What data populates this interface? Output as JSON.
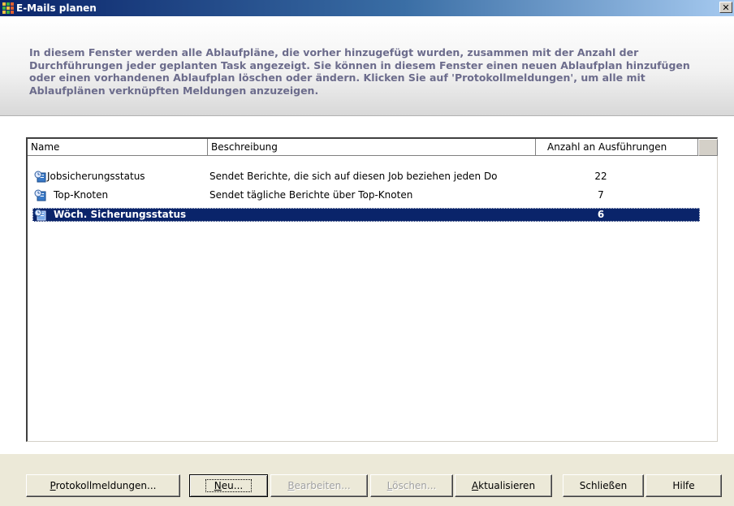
{
  "window": {
    "title": "E-Mails planen",
    "close_glyph": "✕"
  },
  "header": {
    "description": "In diesem Fenster werden alle Ablaufpläne, die vorher hinzugefügt wurden, zusammen mit der Anzahl der Durchführungen jeder geplanten Task angezeigt. Sie können in diesem Fenster einen neuen Ablaufplan hinzufügen oder einen vorhandenen Ablaufplan löschen oder ändern. Klicken Sie auf 'Protokollmeldungen', um alle mit Ablaufplänen verknüpften Meldungen anzuzeigen."
  },
  "list": {
    "columns": [
      "Name",
      "Beschreibung",
      "Anzahl an Ausführungen"
    ],
    "rows": [
      {
        "name": "Jobsicherungsstatus",
        "description": "Sendet Berichte, die sich auf diesen Job beziehen jeden Do",
        "count": "22",
        "icon": "email-schedule-icon",
        "selected": false
      },
      {
        "name": "Top-Knoten",
        "description": "Sendet tägliche Berichte über Top-Knoten",
        "count": "7",
        "icon": "email-schedule-icon",
        "selected": false
      },
      {
        "name": "Wöch. Sicherungsstatus",
        "description": "",
        "count": "6",
        "icon": "email-schedule-icon",
        "selected": true
      }
    ]
  },
  "buttons": {
    "log_messages": {
      "mnemonic": "P",
      "rest": "rotokollmeldungen..."
    },
    "new": {
      "mnemonic": "N",
      "rest": "eu..."
    },
    "edit": {
      "mnemonic": "B",
      "rest": "earbeiten..."
    },
    "delete": {
      "mnemonic": "L",
      "rest": "öschen..."
    },
    "refresh": {
      "mnemonic": "A",
      "rest": "ktualisieren"
    },
    "close": "Schließen",
    "help": "Hilfe"
  },
  "colors": {
    "selection": "#0a246a",
    "header_text": "#6c6c8c"
  }
}
